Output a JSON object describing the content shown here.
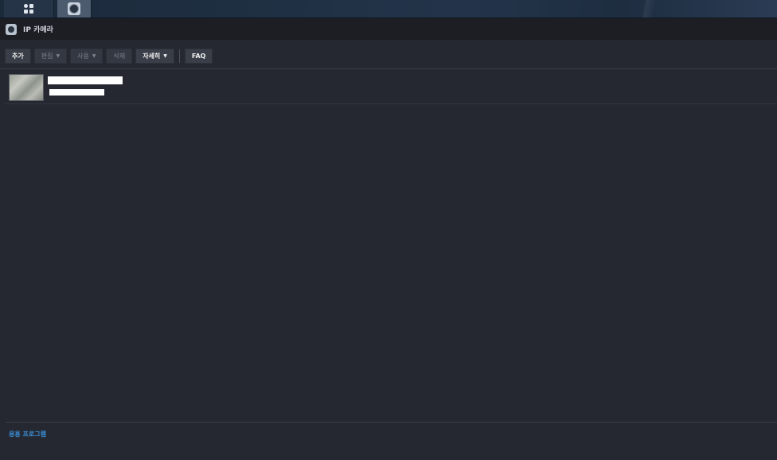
{
  "taskbar": {
    "main_menu_icon": "grid-icon",
    "active_app_icon": "camera-icon"
  },
  "app": {
    "title": "IP 카메라",
    "icon": "camera-icon"
  },
  "toolbar": {
    "add_label": "추가",
    "edit_label": "편집",
    "enable_label": "사용",
    "delete_label": "삭제",
    "more_label": "자세히",
    "faq_label": "FAQ"
  },
  "cameras": [
    {
      "name": "",
      "ip": ""
    }
  ],
  "footer": {
    "link_label": "응용 프로그램"
  },
  "colors": {
    "background": "#252831",
    "titlebar": "#1c1e24",
    "link": "#3a8fd8"
  }
}
